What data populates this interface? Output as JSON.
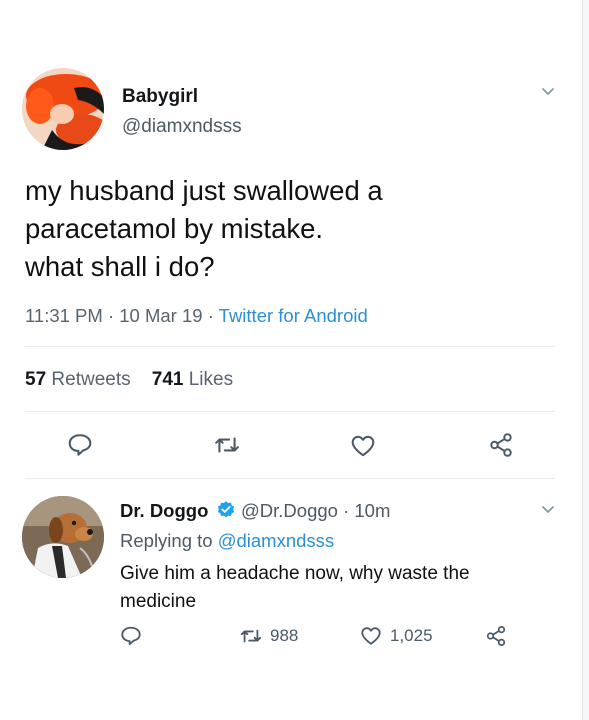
{
  "tweet": {
    "display_name": "Babygirl",
    "handle": "@diamxndsss",
    "text_lines": [
      "my husband just swallowed a",
      "paracetamol by mistake.",
      "what shall i do?"
    ],
    "time": "11:31 PM",
    "date": "10 Mar 19",
    "source": "Twitter for Android",
    "retweets_count": "57",
    "retweets_label": "Retweets",
    "likes_count": "741",
    "likes_label": "Likes"
  },
  "reply": {
    "display_name": "Dr. Doggo",
    "handle_time": "@Dr.Doggo · 10m",
    "replying_prefix": "Replying to",
    "replying_to": "@diamxndsss",
    "text": "Give him a headache now, why waste the medicine",
    "retweet_count": "988",
    "like_count": "1,025"
  },
  "colors": {
    "link": "#2a8fd4",
    "verified": "#1da1f2",
    "muted": "#586470"
  },
  "icons": {
    "reply": "reply-icon",
    "retweet": "retweet-icon",
    "like": "heart-icon",
    "share": "share-icon",
    "menu": "chevron-down-icon",
    "verified": "verified-badge-icon"
  }
}
